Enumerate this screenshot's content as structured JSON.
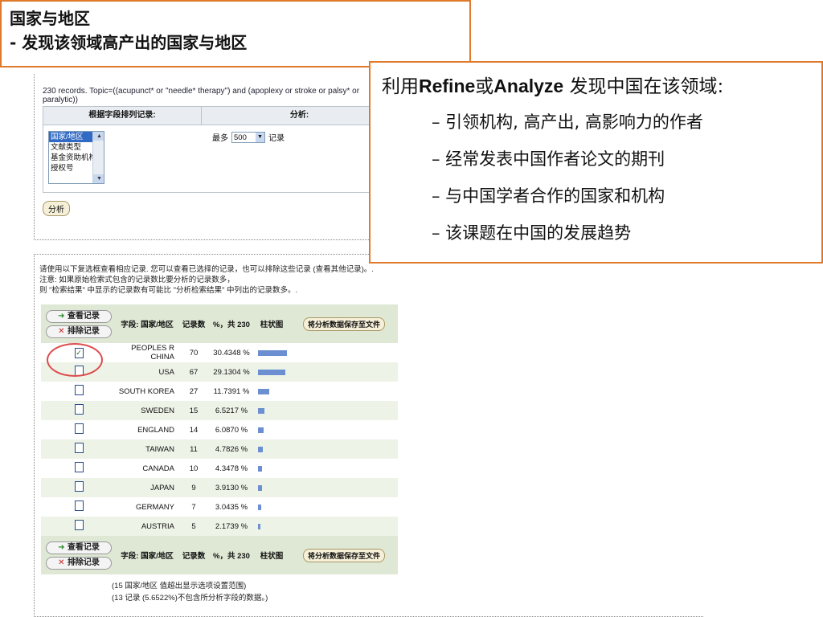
{
  "slide": {
    "title_line1": "国家与地区",
    "title_line2": "- 发现该领域高产出的国家与地区"
  },
  "callout": {
    "heading_pre": "利用",
    "heading_b1": "Refine",
    "heading_mid": "或",
    "heading_b2": "Analyze",
    "heading_post": " 发现中国在该领域:",
    "bullets": [
      "– 引领机构, 高产出, 高影响力的作者",
      "– 经常发表中国作者论文的期刊",
      "– 与中国学者合作的国家和机构",
      "– 该课题在中国的发展趋势"
    ]
  },
  "analyze_panel": {
    "query_text": "230 records. Topic=((acupunct* or \"needle* therapy\") and (apoplexy or stroke or palsy* or paralytic))",
    "left_header": "根据字段排列记录:",
    "right_header": "分析:",
    "field_options": [
      "国家/地区",
      "文献类型",
      "基金资助机构",
      "授权号"
    ],
    "selected_field": "国家/地区",
    "max_label": "最多",
    "max_value": "500",
    "records_label": "记录",
    "analyze_button": "分析"
  },
  "results_panel": {
    "notes": [
      "请使用以下复选框查看相应记录. 您可以查看已选择的记录，也可以排除这些记录 (查看其他记录)。.",
      "注意: 如果原始检索式包含的记录数比要分析的记录数多，",
      "则 \"检索结果\" 中显示的记录数有可能比 \"分析检索结果\" 中列出的记录数多。."
    ],
    "notes_bold_prefix": "注意",
    "view_button": "查看记录",
    "exclude_button": "排除记录",
    "col_field": "字段: 国家/地区",
    "col_count": "记录数",
    "col_pct": "%，共 230",
    "col_bar": "柱状图",
    "save_button": "将分析数据保存至文件",
    "rows": [
      {
        "name": "PEOPLES R CHINA",
        "count": "70",
        "pct": "30.4348 %",
        "share": 30.4348,
        "checked": true
      },
      {
        "name": "USA",
        "count": "67",
        "pct": "29.1304 %",
        "share": 29.1304,
        "checked": false
      },
      {
        "name": "SOUTH KOREA",
        "count": "27",
        "pct": "11.7391 %",
        "share": 11.7391,
        "checked": false
      },
      {
        "name": "SWEDEN",
        "count": "15",
        "pct": "6.5217 %",
        "share": 6.5217,
        "checked": false
      },
      {
        "name": "ENGLAND",
        "count": "14",
        "pct": "6.0870 %",
        "share": 6.087,
        "checked": false
      },
      {
        "name": "TAIWAN",
        "count": "11",
        "pct": "4.7826 %",
        "share": 4.7826,
        "checked": false
      },
      {
        "name": "CANADA",
        "count": "10",
        "pct": "4.3478 %",
        "share": 4.3478,
        "checked": false
      },
      {
        "name": "JAPAN",
        "count": "9",
        "pct": "3.9130 %",
        "share": 3.913,
        "checked": false
      },
      {
        "name": "GERMANY",
        "count": "7",
        "pct": "3.0435 %",
        "share": 3.0435,
        "checked": false
      },
      {
        "name": "AUSTRIA",
        "count": "5",
        "pct": "2.1739 %",
        "share": 2.1739,
        "checked": false
      }
    ],
    "summary_line1": "(15 国家/地区 值超出显示选项设置范围)",
    "summary_line2": "(13 记录 (5.6522%)不包含所分析字段的数据。)"
  },
  "colors": {
    "accent_border": "#e07a2a",
    "bar": "#6b8fd0",
    "highlight_circle": "#dd4b4b"
  }
}
